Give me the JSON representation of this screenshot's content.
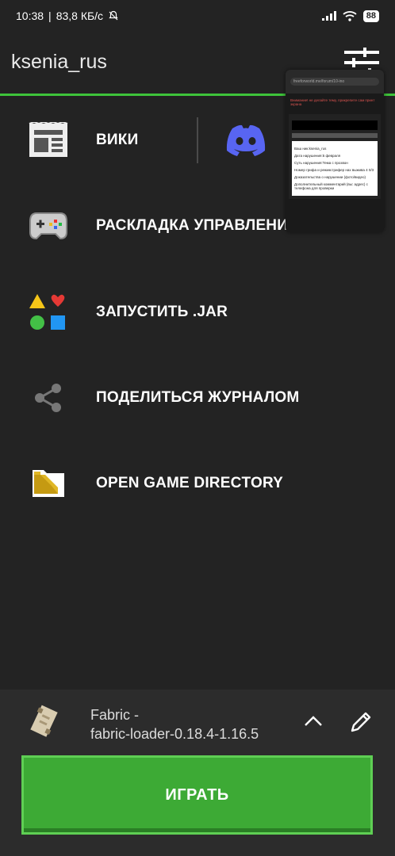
{
  "status_bar": {
    "time": "10:38",
    "speed": "83,8 КБ/с",
    "battery": "88"
  },
  "header": {
    "username": "ksenia_rus"
  },
  "menu": {
    "items": [
      {
        "label": "ВИКИ",
        "icon": "wiki-icon"
      },
      {
        "label": "РАСКЛАДКА УПРАВЛЕНИЯ",
        "icon": "gamepad-icon"
      },
      {
        "label": "ЗАПУСТИТЬ .JAR",
        "icon": "shapes-icon"
      },
      {
        "label": "ПОДЕЛИТЬСЯ ЖУРНАЛОМ",
        "icon": "share-icon"
      },
      {
        "label": "OPEN GAME DIRECTORY",
        "icon": "folder-icon"
      }
    ],
    "discord_icon": "discord-icon"
  },
  "overlay": {
    "url": "freeforworld.me/forum/10-ino",
    "warning": "Внимание! не делайте тему, прикрепите сам принт экрана",
    "content_lines": [
      "Ваш ник:ksenia_rus",
      "Дата нарушения:5 февраля",
      "Суть нарушения:Тема с прозвон",
      "Номер грифа и режим:грифер нах выжива 4 0/3",
      "Доказательства о нарушении (фото/видео)",
      "Дополнительный комментарий (вы: адрес) с телефона для проверки"
    ]
  },
  "version": {
    "line1": "Fabric -",
    "line2": "fabric-loader-0.18.4-1.16.5"
  },
  "play_button": {
    "label": "ИГРАТЬ"
  },
  "colors": {
    "accent": "#3ec43a",
    "background": "#232323",
    "play": "#3daa35",
    "discord": "#5865f2"
  }
}
